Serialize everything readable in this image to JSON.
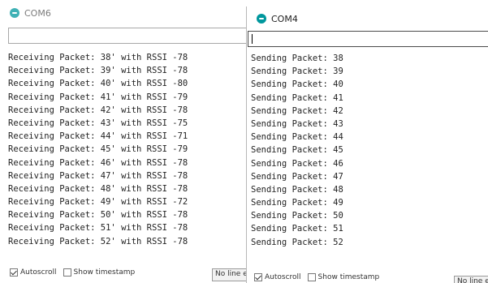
{
  "com6": {
    "title": "COM6",
    "input_value": "",
    "lines": [
      "Receiving Packet: 38' with RSSI -78",
      "Receiving Packet: 39' with RSSI -78",
      "Receiving Packet: 40' with RSSI -80",
      "Receiving Packet: 41' with RSSI -79",
      "Receiving Packet: 42' with RSSI -78",
      "Receiving Packet: 43' with RSSI -75",
      "Receiving Packet: 44' with RSSI -71",
      "Receiving Packet: 45' with RSSI -79",
      "Receiving Packet: 46' with RSSI -78",
      "Receiving Packet: 47' with RSSI -78",
      "Receiving Packet: 48' with RSSI -78",
      "Receiving Packet: 49' with RSSI -72",
      "Receiving Packet: 50' with RSSI -78",
      "Receiving Packet: 51' with RSSI -78",
      "Receiving Packet: 52' with RSSI -78"
    ],
    "footer": {
      "autoscroll_label": "Autoscroll",
      "autoscroll_checked": true,
      "timestamp_label": "Show timestamp",
      "timestamp_checked": false,
      "line_ending": "No line en"
    }
  },
  "com4": {
    "title": "COM4",
    "input_value": "",
    "lines": [
      "Sending Packet: 38",
      "Sending Packet: 39",
      "Sending Packet: 40",
      "Sending Packet: 41",
      "Sending Packet: 42",
      "Sending Packet: 43",
      "Sending Packet: 44",
      "Sending Packet: 45",
      "Sending Packet: 46",
      "Sending Packet: 47",
      "Sending Packet: 48",
      "Sending Packet: 49",
      "Sending Packet: 50",
      "Sending Packet: 51",
      "Sending Packet: 52"
    ],
    "footer": {
      "autoscroll_label": "Autoscroll",
      "autoscroll_checked": true,
      "timestamp_label": "Show timestamp",
      "timestamp_checked": false,
      "line_ending": "No line en"
    }
  },
  "colors": {
    "app_icon": "#00979d",
    "text": "#222222",
    "background": "#ffffff"
  }
}
